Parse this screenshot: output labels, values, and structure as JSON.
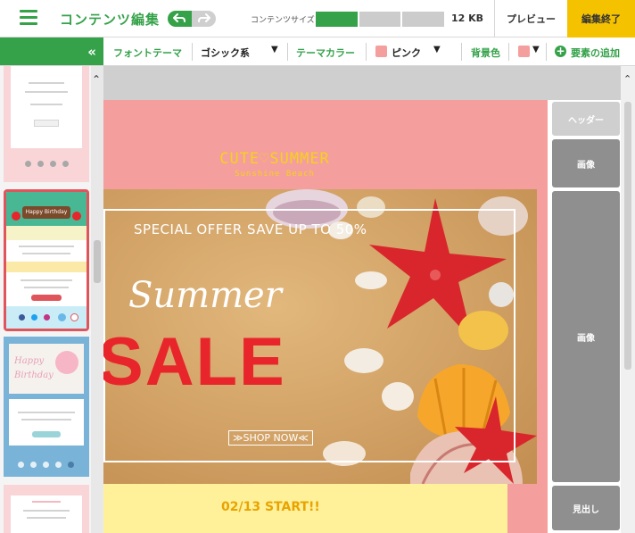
{
  "header": {
    "title": "コンテンツ編集",
    "size_label": "コンテンツサイズ",
    "size_value": "12 KB",
    "size_progress": 0.33,
    "preview_label": "プレビュー",
    "finish_label": "編集終了"
  },
  "toolbar": {
    "collapse_glyph": "«",
    "font_theme_label": "フォントテーマ",
    "font_theme_value": "ゴシック系",
    "theme_color_label": "テーマカラー",
    "theme_color_value": "ピンク",
    "bg_color_label": "背景色",
    "add_element_label": "要素の追加",
    "theme_swatch_color": "#f59e9e",
    "bg_swatch_color": "#f59e9e"
  },
  "email": {
    "brand": "CUTE♡SUMMER",
    "brand_sub": "Sunshine Beach",
    "offer": "SPECIAL OFFER SAVE UP TO 50%",
    "summer": "Summer",
    "sale": "SALE",
    "shop": "≫SHOP NOW≪",
    "date": "02/13 START!!"
  },
  "thumbnails": {
    "birthday_title": "Happy Birthday",
    "birthday_script_1": "Happy",
    "birthday_script_2": "Birthday"
  },
  "elements": {
    "header": "ヘッダー",
    "image_1": "画像",
    "image_2": "画像",
    "heading": "見出し"
  },
  "colors": {
    "brand_green": "#35a24a",
    "accent_yellow": "#f5c200",
    "email_pink": "#f59e9e",
    "sale_red": "#e8252b",
    "date_yellow": "#fef19a"
  }
}
